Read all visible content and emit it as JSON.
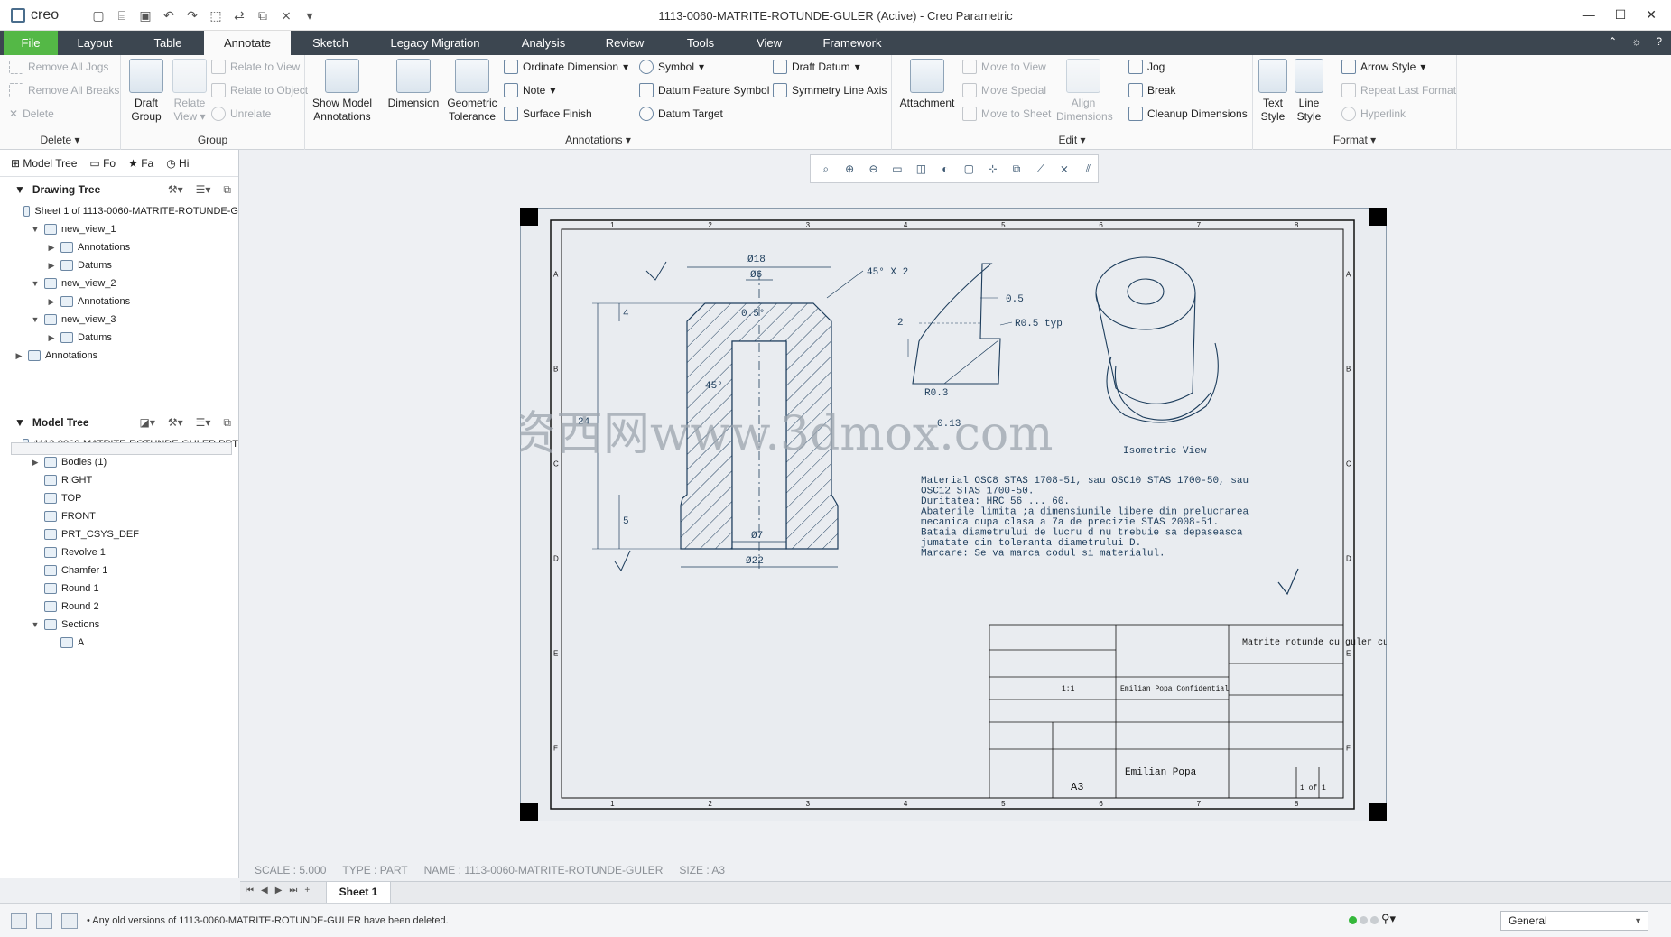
{
  "window": {
    "app_name": "creo",
    "title": "1113-0060-MATRITE-ROTUNDE-GULER (Active) - Creo Parametric",
    "minimize": "—",
    "maximize": "☐",
    "close": "✕"
  },
  "tabs": {
    "file": "File",
    "layout": "Layout",
    "table": "Table",
    "annotate": "Annotate",
    "sketch": "Sketch",
    "legacy": "Legacy Migration",
    "analysis": "Analysis",
    "review": "Review",
    "tools": "Tools",
    "view": "View",
    "framework": "Framework"
  },
  "ribbon": {
    "delete": {
      "remove_jogs": "Remove All Jogs",
      "remove_breaks": "Remove All Breaks",
      "delete": "Delete",
      "label": "Delete ▾"
    },
    "group": {
      "draft_group": "Draft Group",
      "relate_view": "Relate View ▾",
      "relate_to_view": "Relate to View",
      "relate_to_object": "Relate to Object",
      "unrelate": "Unrelate",
      "label": "Group"
    },
    "annotations": {
      "show_model": "Show Model Annotations",
      "dimension": "Dimension",
      "geometric_tolerance": "Geometric Tolerance",
      "ordinate": "Ordinate Dimension",
      "note": "Note",
      "surface_finish": "Surface Finish",
      "symbol": "Symbol",
      "datum_feature": "Datum Feature Symbol",
      "datum_target": "Datum Target",
      "draft_datum": "Draft Datum",
      "symmetry_line": "Symmetry Line Axis",
      "label": "Annotations ▾"
    },
    "edit": {
      "attachment": "Attachment",
      "move_to_view": "Move to View",
      "move_special": "Move Special",
      "move_to_sheet": "Move to Sheet",
      "align_dims": "Align Dimensions",
      "jog": "Jog",
      "break": "Break",
      "cleanup": "Cleanup Dimensions",
      "label": "Edit ▾"
    },
    "format": {
      "text_style": "Text Style",
      "line_style": "Line Style",
      "arrow_style": "Arrow Style",
      "repeat_last": "Repeat Last Format",
      "hyperlink": "Hyperlink",
      "label": "Format ▾"
    }
  },
  "left_panel": {
    "tabs": {
      "model_tree": "Model Tree",
      "folder": "Fo",
      "favorites": "Fa",
      "history": "Hi"
    },
    "drawing_tree": {
      "title": "Drawing Tree",
      "items": [
        {
          "label": "Sheet 1 of 1113-0060-MATRITE-ROTUNDE-G",
          "indent": 0,
          "arrow": ""
        },
        {
          "label": "new_view_1",
          "indent": 1,
          "arrow": "▼"
        },
        {
          "label": "Annotations",
          "indent": 2,
          "arrow": "▶"
        },
        {
          "label": "Datums",
          "indent": 2,
          "arrow": "▶"
        },
        {
          "label": "new_view_2",
          "indent": 1,
          "arrow": "▼"
        },
        {
          "label": "Annotations",
          "indent": 2,
          "arrow": "▶"
        },
        {
          "label": "new_view_3",
          "indent": 1,
          "arrow": "▼"
        },
        {
          "label": "Datums",
          "indent": 2,
          "arrow": "▶"
        },
        {
          "label": "Annotations",
          "indent": 0,
          "arrow": "▶"
        }
      ]
    },
    "model_tree": {
      "title": "Model Tree",
      "items": [
        {
          "label": "1113-0060-MATRITE-ROTUNDE-GULER.PRT",
          "indent": 0,
          "arrow": ""
        },
        {
          "label": "Bodies (1)",
          "indent": 1,
          "arrow": "▶"
        },
        {
          "label": "RIGHT",
          "indent": 1,
          "arrow": ""
        },
        {
          "label": "TOP",
          "indent": 1,
          "arrow": ""
        },
        {
          "label": "FRONT",
          "indent": 1,
          "arrow": ""
        },
        {
          "label": "PRT_CSYS_DEF",
          "indent": 1,
          "arrow": ""
        },
        {
          "label": "Revolve 1",
          "indent": 1,
          "arrow": ""
        },
        {
          "label": "Chamfer 1",
          "indent": 1,
          "arrow": ""
        },
        {
          "label": "Round 1",
          "indent": 1,
          "arrow": ""
        },
        {
          "label": "Round 2",
          "indent": 1,
          "arrow": ""
        },
        {
          "label": "Sections",
          "indent": 1,
          "arrow": "▼"
        },
        {
          "label": "A",
          "indent": 2,
          "arrow": ""
        }
      ]
    }
  },
  "drawing": {
    "zone_cols": [
      "1",
      "2",
      "3",
      "4",
      "5",
      "6",
      "7",
      "8"
    ],
    "zone_rows": [
      "A",
      "B",
      "C",
      "D",
      "E",
      "F"
    ],
    "dims": {
      "d18": "Ø18",
      "d6": "Ø6",
      "chamfer": "45° X 2",
      "ang05": "0.5°",
      "h4": "4",
      "ang45": "45°",
      "h24": "24",
      "h5": "5",
      "d7": "Ø7",
      "d22": "Ø22",
      "r013": "0.13",
      "d05": "0.5",
      "r05typ": "R0.5 typ",
      "h2": "2",
      "r03": "R0.3"
    },
    "iso_label": "Isometric View",
    "notes": [
      "Material OSC8 STAS 1708-51, sau OSC10 STAS 1700-50, sau",
      "OSC12 STAS 1700-50.",
      "Duritatea: HRC 56 ... 60.",
      "Abaterile limita ;a dimensiunile libere din prelucrarea",
      "mecanica dupa clasa a 7a de precizie STAS 2008-51.",
      "Bataia diametrului de lucru d nu trebuie sa depaseasca",
      "jumatate din toleranta diametrului D.",
      "Marcare: Se va marca codul si materialul."
    ],
    "title_block": {
      "description": "Matrite rotunde cu guler cu pereti grosi",
      "author": "Emilian Popa",
      "size": "A3",
      "sheet": "1 of 1",
      "confidential": "Emilian Popa Confidential",
      "scale": "1:1"
    },
    "watermark": "资西网www.3dmox.com"
  },
  "view_toolbar": [
    "⌕",
    "⊕",
    "⊖",
    "▭",
    "◫",
    "◐",
    "▢",
    "⊹",
    "⧉",
    "⟋",
    "⨯",
    "⫽"
  ],
  "info": {
    "scale": "SCALE : 5.000",
    "type": "TYPE : PART",
    "name": "NAME : 1113-0060-MATRITE-ROTUNDE-GULER",
    "size": "SIZE : A3"
  },
  "sheetbar": {
    "sheet_tab": "Sheet 1",
    "add": "+"
  },
  "status": {
    "message": "• Any old versions of 1113-0060-MATRITE-ROTUNDE-GULER have been deleted.",
    "filter": "General"
  }
}
